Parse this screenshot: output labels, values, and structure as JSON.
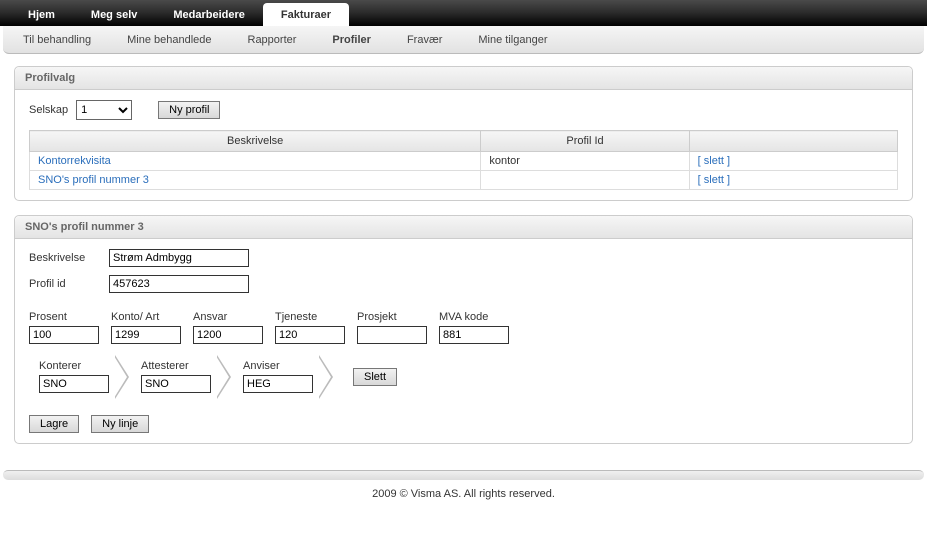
{
  "mainTabs": [
    {
      "label": "Hjem",
      "active": false
    },
    {
      "label": "Meg selv",
      "active": false
    },
    {
      "label": "Medarbeidere",
      "active": false
    },
    {
      "label": "Fakturaer",
      "active": true
    }
  ],
  "subTabs": [
    {
      "label": "Til behandling",
      "active": false
    },
    {
      "label": "Mine behandlede",
      "active": false
    },
    {
      "label": "Rapporter",
      "active": false
    },
    {
      "label": "Profiler",
      "active": true
    },
    {
      "label": "Fravær",
      "active": false
    },
    {
      "label": "Mine tilganger",
      "active": false
    }
  ],
  "profilvalg": {
    "title": "Profilvalg",
    "selskapLabel": "Selskap",
    "selskapValue": "1",
    "nyProfilLabel": "Ny profil",
    "columns": {
      "beskrivelse": "Beskrivelse",
      "profilId": "Profil Id",
      "action": ""
    },
    "rows": [
      {
        "beskrivelse": "Kontorrekvisita",
        "profilId": "kontor",
        "action": "[ slett ]"
      },
      {
        "beskrivelse": "SNO's profil nummer 3",
        "profilId": "",
        "action": "[ slett ]"
      }
    ]
  },
  "profilDetail": {
    "title": "SNO's profil nummer 3",
    "beskrivelseLabel": "Beskrivelse",
    "beskrivelseValue": "Strøm Admbygg",
    "profilIdLabel": "Profil id",
    "profilIdValue": "457623",
    "fields": {
      "prosent": {
        "label": "Prosent",
        "value": "100"
      },
      "kontoArt": {
        "label": "Konto/ Art",
        "value": "1299"
      },
      "ansvar": {
        "label": "Ansvar",
        "value": "1200"
      },
      "tjeneste": {
        "label": "Tjeneste",
        "value": "120"
      },
      "prosjekt": {
        "label": "Prosjekt",
        "value": ""
      },
      "mvaKode": {
        "label": "MVA kode",
        "value": "881"
      }
    },
    "roles": {
      "konterer": {
        "label": "Konterer",
        "value": "SNO"
      },
      "attesterer": {
        "label": "Attesterer",
        "value": "SNO"
      },
      "anviser": {
        "label": "Anviser",
        "value": "HEG"
      }
    },
    "slettLabel": "Slett",
    "lagreLabel": "Lagre",
    "nyLinjeLabel": "Ny linje"
  },
  "footer": "2009 © Visma AS. All rights reserved."
}
